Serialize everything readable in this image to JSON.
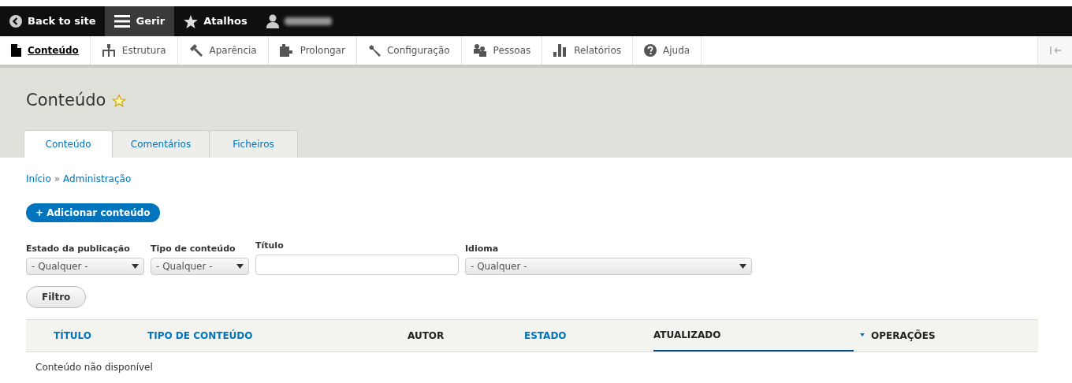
{
  "toolbar": {
    "items": [
      {
        "kind": "back",
        "label": "Back to site",
        "selected": false
      },
      {
        "kind": "menu",
        "label": "Gerir",
        "selected": true
      },
      {
        "kind": "star",
        "label": "Atalhos",
        "selected": false
      },
      {
        "kind": "user",
        "selected": false
      }
    ]
  },
  "admin_menu": {
    "items": [
      {
        "kind": "content",
        "label": "Conteúdo",
        "selected": true
      },
      {
        "kind": "structure",
        "label": "Estrutura",
        "selected": false
      },
      {
        "kind": "appearance",
        "label": "Aparência",
        "selected": false
      },
      {
        "kind": "extend",
        "label": "Prolongar",
        "selected": false
      },
      {
        "kind": "config",
        "label": "Configuração",
        "selected": false
      },
      {
        "kind": "people",
        "label": "Pessoas",
        "selected": false
      },
      {
        "kind": "reports",
        "label": "Relatórios",
        "selected": false
      },
      {
        "kind": "help",
        "label": "Ajuda",
        "selected": false
      }
    ]
  },
  "page_title": "Conteúdo",
  "tabs": [
    {
      "label": "Conteúdo",
      "selected": true
    },
    {
      "label": "Comentários",
      "selected": false
    },
    {
      "label": "Ficheiros",
      "selected": false
    }
  ],
  "breadcrumb": {
    "links": [
      "Início",
      "Administração"
    ],
    "separator": "»"
  },
  "add_button": "+ Adicionar conteúdo",
  "filters": [
    {
      "kind": "select",
      "label": "Estado da publicação",
      "value": "- Qualquer -"
    },
    {
      "kind": "select",
      "label": "Tipo de conteúdo",
      "value": "- Qualquer -"
    },
    {
      "kind": "text",
      "label": "Título"
    },
    {
      "kind": "select",
      "label": "Idioma",
      "value": "- Qualquer -"
    }
  ],
  "filter_button": "Filtro",
  "table": {
    "columns": [
      {
        "label": "TÍTULO",
        "sortable": true,
        "selected": false
      },
      {
        "label": "TIPO DE CONTEÚDO",
        "sortable": true,
        "selected": false
      },
      {
        "label": "AUTOR",
        "sortable": false,
        "selected": false
      },
      {
        "label": "ESTADO",
        "sortable": true,
        "selected": false
      },
      {
        "label": "ATUALIZADO",
        "sortable": true,
        "selected": true
      },
      {
        "label": "OPERAÇÕES",
        "sortable": false,
        "selected": false
      }
    ],
    "empty_message": "Conteúdo não disponível"
  }
}
